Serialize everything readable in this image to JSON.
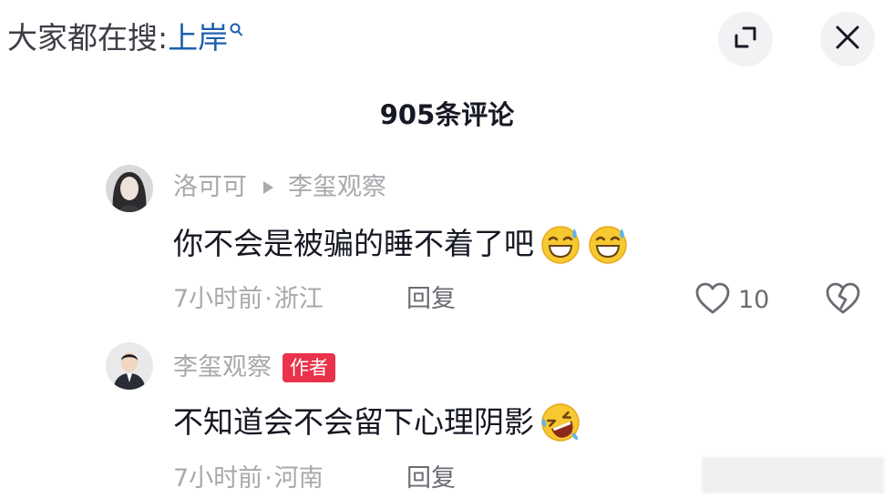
{
  "header": {
    "search_prefix": "大家都在搜:",
    "search_term": "上岸"
  },
  "comments_count_title": "905条评论",
  "comments": [
    {
      "username": "洛可可",
      "reply_to": "李玺观察",
      "text": "你不会是被骗的睡不着了吧",
      "emojis": [
        "laughing-sweat-emoji",
        "laughing-sweat-emoji"
      ],
      "time": "7小时前",
      "location": "浙江",
      "reply_label": "回复",
      "likes": "10"
    },
    {
      "username": "李玺观察",
      "badge": "作者",
      "text": "不知道会不会留下心理阴影",
      "emojis": [
        "rolling-laughing-emoji"
      ],
      "time": "7小时前",
      "location": "河南",
      "reply_label": "回复"
    }
  ],
  "colors": {
    "accent_link": "#1f5fae",
    "author_badge": "#e8334a",
    "muted_text": "#a8a8ad"
  }
}
